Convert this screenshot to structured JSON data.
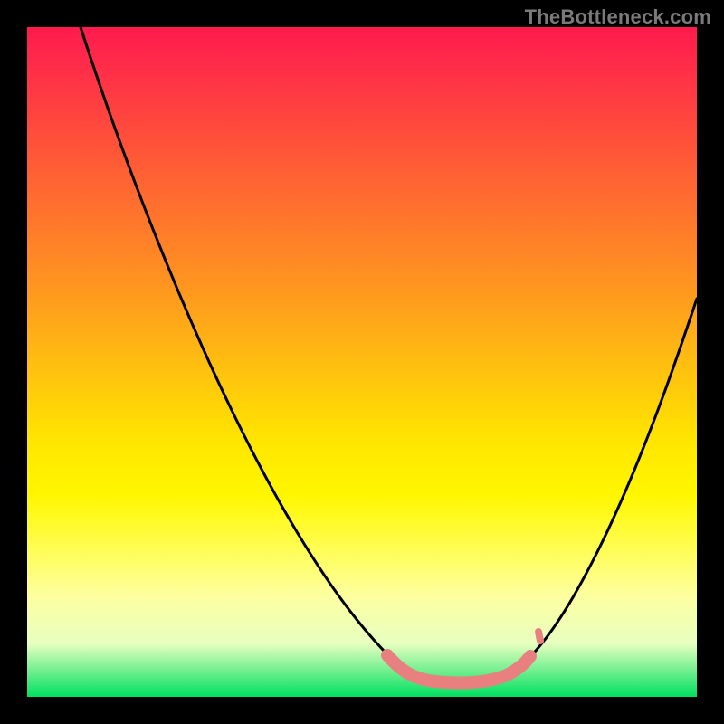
{
  "watermark": "TheBottleneck.com",
  "chart_data": {
    "type": "line",
    "title": "",
    "xlabel": "",
    "ylabel": "",
    "xlim": [
      0,
      100
    ],
    "ylim": [
      0,
      100
    ],
    "grid": false,
    "legend": false,
    "background_gradient_stops": [
      {
        "pos": 0,
        "color": "#ff1a4d"
      },
      {
        "pos": 20,
        "color": "#ff5a36"
      },
      {
        "pos": 40,
        "color": "#ff9a1e"
      },
      {
        "pos": 62,
        "color": "#ffe600"
      },
      {
        "pos": 85,
        "color": "#fdffa0"
      },
      {
        "pos": 100,
        "color": "#00e060"
      }
    ],
    "series": [
      {
        "name": "bottleneck-curve",
        "color": "#000000",
        "x": [
          8,
          16,
          25,
          35,
          45,
          55,
          61,
          65,
          70,
          75,
          80,
          86,
          92,
          100
        ],
        "y": [
          100,
          74,
          55,
          38,
          22,
          9,
          3,
          2,
          2,
          3,
          7,
          17,
          32,
          60
        ]
      },
      {
        "name": "highlight-segment",
        "color": "#e98080",
        "x": [
          54,
          58,
          62,
          66,
          70,
          74,
          76
        ],
        "y": [
          6,
          3,
          2,
          2,
          2,
          3,
          6
        ]
      }
    ],
    "annotations": [
      {
        "text": "TheBottleneck.com",
        "position": "top-right",
        "color": "#7a7a7a"
      }
    ]
  }
}
